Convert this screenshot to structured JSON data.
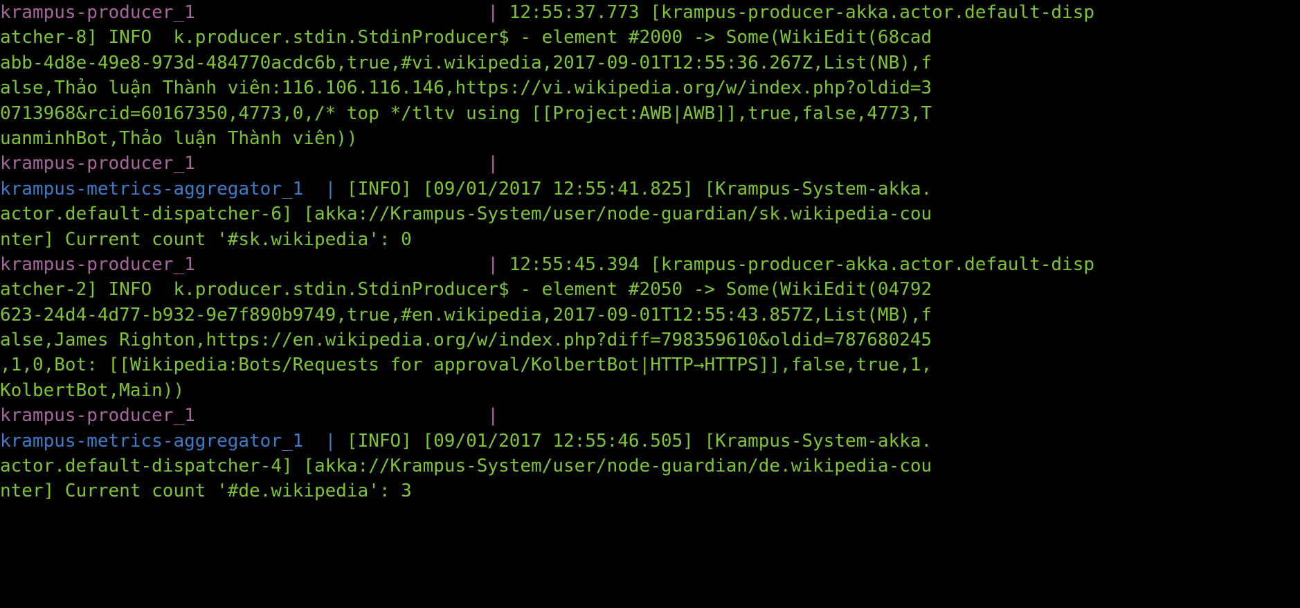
{
  "terminal": {
    "background_color": "#000000",
    "font_size_px": 26,
    "line_height_px": 36,
    "wrap": "clipped",
    "colors": {
      "producer_service": "#a8669f",
      "metrics_service": "#3c7cc8",
      "log_body": "#7ec62f"
    },
    "services": [
      {
        "name": "krampus-producer_1",
        "color": "#a8669f"
      },
      {
        "name": "krampus-metrics-aggregator_1",
        "color": "#3c7cc8"
      }
    ]
  },
  "log": {
    "lines": [
      {
        "service": "krampus-producer_1",
        "service_class": "svc-producer",
        "prefix": "krampus-producer_1                           | ",
        "text": "12:55:37.773 [krampus-producer-akka.actor.default-dispatcher-8] INFO  k.producer.stdin.StdinProducer$ - element #2000 -> Some(WikiEdit(68cadabb-4d8e-49e8-973d-484770acdc6b,true,#vi.wikipedia,2017-09-01T12:55:36.267Z,List(NB),false,Thảo luận Thành viên:116.106.116.146,https://vi.wikipedia.org/w/index.php?oldid=30713968&rcid=60167350,4773,0,/* top */tltv using [[Project:AWB|AWB]],true,false,4773,TuanminhBot,Thảo luận Thành viên))"
      },
      {
        "service": "krampus-producer_1",
        "service_class": "svc-producer",
        "prefix": "krampus-producer_1                           | ",
        "text": ""
      },
      {
        "service": "krampus-metrics-aggregator_1",
        "service_class": "svc-metrics",
        "prefix": "krampus-metrics-aggregator_1  | ",
        "text": "[INFO] [09/01/2017 12:55:41.825] [Krampus-System-akka.actor.default-dispatcher-6] [akka://Krampus-System/user/node-guardian/sk.wikipedia-counter] Current count '#sk.wikipedia': 0"
      },
      {
        "service": "krampus-producer_1",
        "service_class": "svc-producer",
        "prefix": "krampus-producer_1                           | ",
        "text": "12:55:45.394 [krampus-producer-akka.actor.default-dispatcher-2] INFO  k.producer.stdin.StdinProducer$ - element #2050 -> Some(WikiEdit(04792623-24d4-4d77-b932-9e7f890b9749,true,#en.wikipedia,2017-09-01T12:55:43.857Z,List(MB),false,James Righton,https://en.wikipedia.org/w/index.php?diff=798359610&oldid=787680245,1,0,Bot: [[Wikipedia:Bots/Requests for approval/KolbertBot|HTTP→HTTPS]],false,true,1,KolbertBot,Main))"
      },
      {
        "service": "krampus-producer_1",
        "service_class": "svc-producer",
        "prefix": "krampus-producer_1                           | ",
        "text": ""
      },
      {
        "service": "krampus-metrics-aggregator_1",
        "service_class": "svc-metrics",
        "prefix": "krampus-metrics-aggregator_1  | ",
        "text": "[INFO] [09/01/2017 12:55:46.505] [Krampus-System-akka.actor.default-dispatcher-4] [akka://Krampus-System/user/node-guardian/de.wikipedia-counter] Current count '#de.wikipedia': 3"
      }
    ],
    "visual_rows": [
      {
        "segments": [
          {
            "class": "svc-producer",
            "text": "krampus-producer_1                           "
          },
          {
            "class": "svc-producer",
            "text": "| "
          },
          {
            "class": "body",
            "text": "12:55:37.773 [krampus-producer-akka.actor.default-disp"
          }
        ]
      },
      {
        "segments": [
          {
            "class": "body",
            "text": "atcher-8] INFO  k.producer.stdin.StdinProducer$ - element #2000 -> Some(WikiEdit(68cad"
          }
        ]
      },
      {
        "segments": [
          {
            "class": "body",
            "text": "abb-4d8e-49e8-973d-484770acdc6b,true,#vi.wikipedia,2017-09-01T12:55:36.267Z,List(NB),f"
          }
        ]
      },
      {
        "segments": [
          {
            "class": "body",
            "text": "alse,Thảo luận Thành viên:116.106.116.146,https://vi.wikipedia.org/w/index.php?oldid=3"
          }
        ]
      },
      {
        "segments": [
          {
            "class": "body",
            "text": "0713968&rcid=60167350,4773,0,/* top */tltv using [[Project:AWB|AWB]],true,false,4773,T"
          }
        ]
      },
      {
        "segments": [
          {
            "class": "body",
            "text": "uanminhBot,Thảo luận Thành viên))"
          }
        ]
      },
      {
        "segments": [
          {
            "class": "svc-producer",
            "text": "krampus-producer_1                           "
          },
          {
            "class": "svc-producer",
            "text": "|"
          }
        ]
      },
      {
        "segments": [
          {
            "class": "svc-metrics",
            "text": "krampus-metrics-aggregator_1  "
          },
          {
            "class": "svc-metrics",
            "text": "| "
          },
          {
            "class": "body",
            "text": "[INFO] [09/01/2017 12:55:41.825] [Krampus-System-akka."
          }
        ]
      },
      {
        "segments": [
          {
            "class": "body",
            "text": "actor.default-dispatcher-6] [akka://Krampus-System/user/node-guardian/sk.wikipedia-cou"
          }
        ]
      },
      {
        "segments": [
          {
            "class": "body",
            "text": "nter] Current count '#sk.wikipedia': 0"
          }
        ]
      },
      {
        "segments": [
          {
            "class": "svc-producer",
            "text": "krampus-producer_1                           "
          },
          {
            "class": "svc-producer",
            "text": "| "
          },
          {
            "class": "body",
            "text": "12:55:45.394 [krampus-producer-akka.actor.default-disp"
          }
        ]
      },
      {
        "segments": [
          {
            "class": "body",
            "text": "atcher-2] INFO  k.producer.stdin.StdinProducer$ - element #2050 -> Some(WikiEdit(04792"
          }
        ]
      },
      {
        "segments": [
          {
            "class": "body",
            "text": "623-24d4-4d77-b932-9e7f890b9749,true,#en.wikipedia,2017-09-01T12:55:43.857Z,List(MB),f"
          }
        ]
      },
      {
        "segments": [
          {
            "class": "body",
            "text": "alse,James Righton,https://en.wikipedia.org/w/index.php?diff=798359610&oldid=787680245"
          }
        ]
      },
      {
        "segments": [
          {
            "class": "body",
            "text": ",1,0,Bot: [[Wikipedia:Bots/Requests for approval/KolbertBot|HTTP→HTTPS]],false,true,1,"
          }
        ]
      },
      {
        "segments": [
          {
            "class": "body",
            "text": "KolbertBot,Main))"
          }
        ]
      },
      {
        "segments": [
          {
            "class": "svc-producer",
            "text": "krampus-producer_1                           "
          },
          {
            "class": "svc-producer",
            "text": "|"
          }
        ]
      },
      {
        "segments": [
          {
            "class": "svc-metrics",
            "text": "krampus-metrics-aggregator_1  "
          },
          {
            "class": "svc-metrics",
            "text": "| "
          },
          {
            "class": "body",
            "text": "[INFO] [09/01/2017 12:55:46.505] [Krampus-System-akka."
          }
        ]
      },
      {
        "segments": [
          {
            "class": "body",
            "text": "actor.default-dispatcher-4] [akka://Krampus-System/user/node-guardian/de.wikipedia-cou"
          }
        ]
      },
      {
        "segments": [
          {
            "class": "body",
            "text": "nter] Current count '#de.wikipedia': 3"
          }
        ]
      }
    ]
  }
}
